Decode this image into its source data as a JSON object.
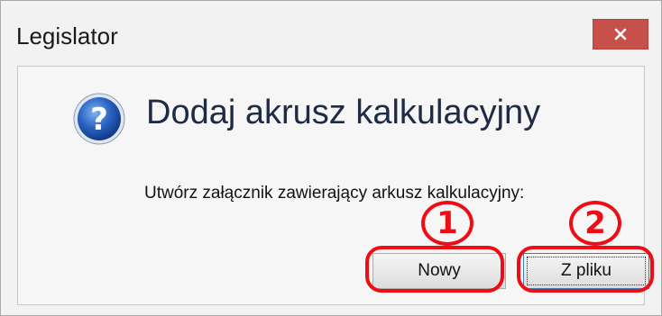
{
  "window": {
    "title": "Legislator",
    "close_glyph": "close-icon"
  },
  "dialog": {
    "icon": "question-icon",
    "heading": "Dodaj akrusz kalkulacyjny",
    "message": "Utwórz załącznik zawierający arkusz kalkulacyjny:"
  },
  "buttons": {
    "new_label": "Nowy",
    "from_file_label": "Z pliku"
  },
  "annotations": {
    "marker_1": "1",
    "marker_2": "2",
    "color": "#ee0d14"
  },
  "colors": {
    "close_button": "#c7514a",
    "heading_text": "#1f2a44",
    "focus_border": "#3c7fb1"
  }
}
